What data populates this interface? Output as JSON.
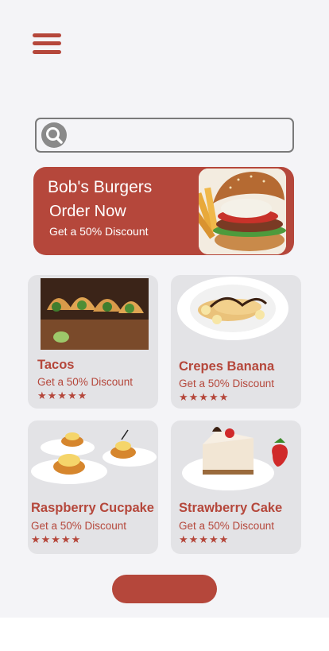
{
  "menu": {
    "icon": "hamburger-menu-icon"
  },
  "search": {
    "icon": "search-icon",
    "value": "",
    "placeholder": ""
  },
  "banner": {
    "title": "Bob's Burgers",
    "subtitle": "Order Now",
    "discount": "Get a 50% Discount",
    "image": "burger-with-fries-photo"
  },
  "items": [
    {
      "title": "Tacos",
      "discount": "Get a 50% Discount",
      "stars": "★★★★★",
      "rating": 5,
      "image": "tacos-photo"
    },
    {
      "title": "Crepes Banana",
      "discount": "Get a 50% Discount",
      "stars": "★★★★★",
      "rating": 5,
      "image": "crepes-banana-photo"
    },
    {
      "title": "Raspberry Cucpake",
      "discount": "Get a 50% Discount",
      "stars": "★★★★★",
      "rating": 5,
      "image": "raspberry-cupcakes-photo"
    },
    {
      "title": "Strawberry Cake",
      "discount": "Get a 50% Discount",
      "stars": "★★★★★",
      "rating": 5,
      "image": "strawberry-cake-photo"
    }
  ],
  "cta": {
    "label": ""
  },
  "colors": {
    "accent": "#b5473b",
    "background": "#f4f4f7",
    "card": "#e3e3e6"
  }
}
